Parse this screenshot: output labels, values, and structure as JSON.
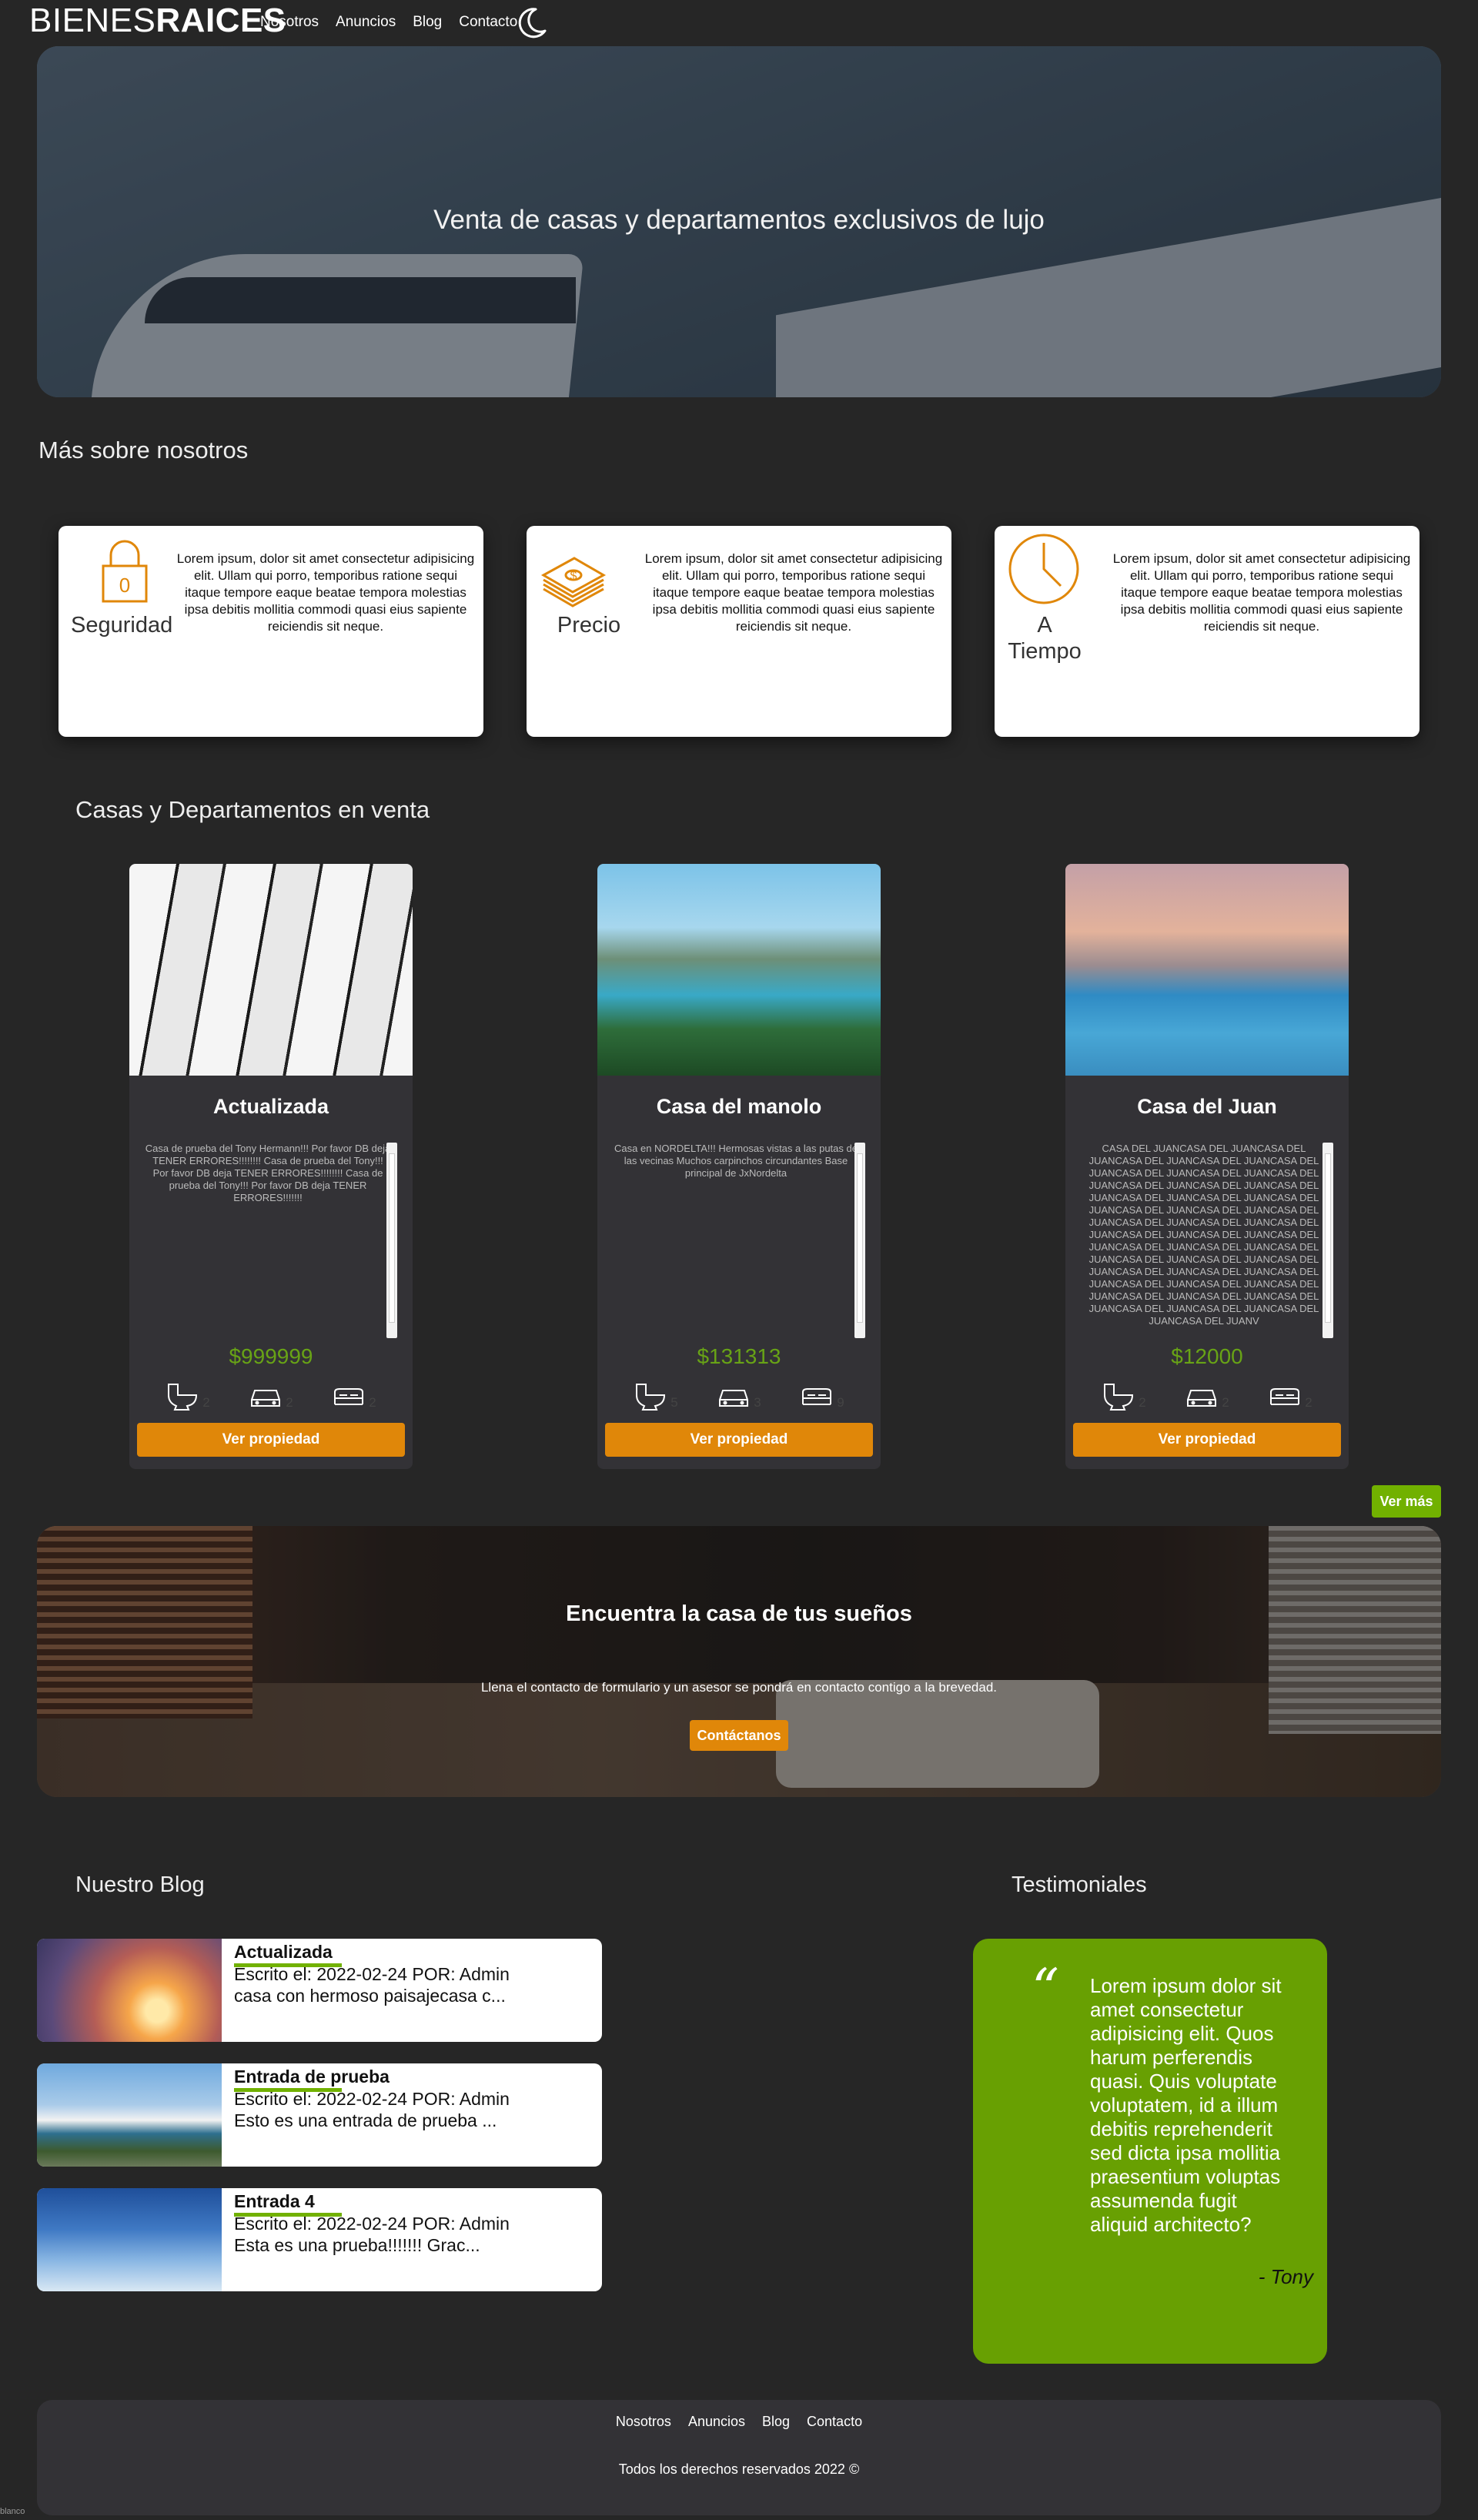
{
  "header": {
    "logo_light": "BIENES",
    "logo_bold": "RAICES",
    "nav": [
      "Nosotros",
      "Anuncios",
      "Blog",
      "Contacto"
    ],
    "theme_toggle_icon": "moon-icon"
  },
  "hero": {
    "title": "Venta de casas y departamentos exclusivos de lujo"
  },
  "about": {
    "title": "Más sobre nosotros",
    "features": [
      {
        "icon": "lock-icon",
        "label": "Seguridad",
        "text": "Lorem ipsum, dolor sit amet consectetur adipisicing elit. Ullam qui porro, temporibus ratione sequi itaque tempore eaque beatae tempora molestias ipsa debitis mollitia commodi quasi eius sapiente reiciendis sit neque."
      },
      {
        "icon": "money-icon",
        "label": "Precio",
        "text": "Lorem ipsum, dolor sit amet consectetur adipisicing elit. Ullam qui porro, temporibus ratione sequi itaque tempore eaque beatae tempora molestias ipsa debitis mollitia commodi quasi eius sapiente reiciendis sit neque."
      },
      {
        "icon": "clock-icon",
        "label": "A Tiempo",
        "text": "Lorem ipsum, dolor sit amet consectetur adipisicing elit. Ullam qui porro, temporibus ratione sequi itaque tempore eaque beatae tempora molestias ipsa debitis mollitia commodi quasi eius sapiente reiciendis sit neque."
      }
    ]
  },
  "listings": {
    "title": "Casas y Departamentos en venta",
    "items": [
      {
        "title": "Actualizada",
        "description": "Casa de prueba del Tony Hermann!!! Por favor DB deja TENER ERRORES!!!!!!!! Casa de prueba del Tony!!! Por favor DB deja TENER ERRORES!!!!!!!! Casa de prueba del Tony!!! Por favor DB deja TENER ERRORES!!!!!!!",
        "price": "$999999",
        "wc": "2",
        "parking": "2",
        "rooms": "2",
        "button": "Ver propiedad"
      },
      {
        "title": "Casa del manolo",
        "description": "Casa en NORDELTA!!! Hermosas vistas a las putas de las vecinas Muchos carpinchos circundantes Base principal de JxNordelta",
        "price": "$131313",
        "wc": "5",
        "parking": "3",
        "rooms": "9",
        "button": "Ver propiedad"
      },
      {
        "title": "Casa del Juan",
        "description": "CASA DEL JUANCASA DEL JUANCASA DEL JUANCASA DEL JUANCASA DEL JUANCASA DEL JUANCASA DEL JUANCASA DEL JUANCASA DEL JUANCASA DEL JUANCASA DEL JUANCASA DEL JUANCASA DEL JUANCASA DEL JUANCASA DEL JUANCASA DEL JUANCASA DEL JUANCASA DEL JUANCASA DEL JUANCASA DEL JUANCASA DEL JUANCASA DEL JUANCASA DEL JUANCASA DEL JUANCASA DEL JUANCASA DEL JUANCASA DEL JUANCASA DEL JUANCASA DEL JUANCASA DEL JUANCASA DEL JUANCASA DEL JUANCASA DEL JUANCASA DEL JUANCASA DEL JUANCASA DEL JUANCASA DEL JUANCASA DEL JUANCASA DEL JUANCASA DEL JUANCASA DEL JUANCASA DEL JUANCASA DEL JUANV",
        "price": "$12000",
        "wc": "2",
        "parking": "2",
        "rooms": "2",
        "button": "Ver propiedad"
      }
    ],
    "more_button": "Ver más"
  },
  "contact_banner": {
    "title": "Encuentra la casa de tus sueños",
    "text": "Llena el contacto de formulario y un asesor se pondrá en contacto contigo a la brevedad.",
    "button": "Contáctanos"
  },
  "blog": {
    "title": "Nuestro Blog",
    "posts": [
      {
        "title": "Actualizada",
        "meta": "Escrito el: 2022-02-24 POR: Admin",
        "excerpt": "casa con hermoso paisajecasa c..."
      },
      {
        "title": "Entrada de prueba",
        "meta": "Escrito el: 2022-02-24 POR: Admin",
        "excerpt": "Esto es una entrada de prueba ..."
      },
      {
        "title": "Entrada 4",
        "meta": "Escrito el: 2022-02-24 POR: Admin",
        "excerpt": "Esta es una prueba!!!!!!! Grac..."
      }
    ]
  },
  "testimonials": {
    "title": "Testimoniales",
    "quote_mark": "“",
    "text": "Lorem ipsum dolor sit amet consectetur adipisicing elit. Quos harum perferendis quasi. Quis voluptate voluptatem, id a illum debitis reprehenderit sed dicta ipsa mollitia praesentium voluptas assumenda fugit aliquid architecto?",
    "author": "- Tony"
  },
  "footer": {
    "nav": [
      "Nosotros",
      "Anuncios",
      "Blog",
      "Contacto"
    ],
    "copyright": "Todos los derechos reservados 2022 ©"
  },
  "bottom_text": "blanco",
  "colors": {
    "background": "#262626",
    "accent_orange": "#e08709",
    "accent_green": "#71b100",
    "price_green": "#68a316",
    "card_dark": "#333236"
  }
}
